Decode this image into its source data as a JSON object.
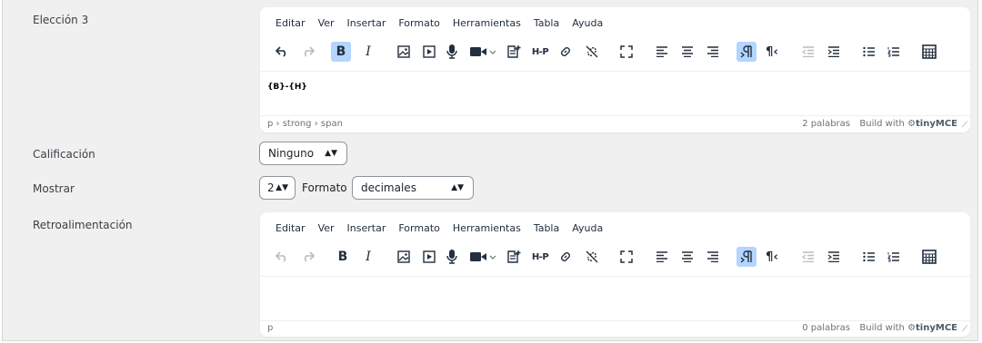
{
  "form": {
    "choice": {
      "label": "Elección 3"
    },
    "grade": {
      "label": "Calificación",
      "value": "Ninguno"
    },
    "show": {
      "label": "Mostrar",
      "value": "2",
      "format_label": "Formato",
      "format_value": "decimales"
    },
    "feedback": {
      "label": "Retroalimentación"
    }
  },
  "editor_menu": [
    "Editar",
    "Ver",
    "Insertar",
    "Formato",
    "Herramientas",
    "Tabla",
    "Ayuda"
  ],
  "editor1": {
    "content": "{B}-{H}",
    "path": "p › strong › span",
    "words": "2 palabras",
    "build_with": "Build with",
    "brand": "tinyMCE"
  },
  "editor2": {
    "content": "",
    "path": "p",
    "words": "0 palabras",
    "build_with": "Build with",
    "brand": "tinyMCE"
  },
  "toolbar_icons": [
    "undo-icon",
    "redo-icon",
    "bold-icon",
    "italic-icon",
    "image-icon",
    "media-icon",
    "microphone-icon",
    "video-icon",
    "h5p-insert-icon",
    "h5p-icon",
    "link-icon",
    "unlink-icon",
    "fullscreen-icon",
    "align-left-icon",
    "align-center-icon",
    "align-right-icon",
    "ltr-icon",
    "rtl-icon",
    "outdent-icon",
    "indent-icon",
    "bullet-list-icon",
    "numbered-list-icon",
    "calculator-icon"
  ],
  "toolbar_text": {
    "bold": "B",
    "italic": "I",
    "h5p": "H-P",
    "rtl": "¶‹"
  },
  "colors": {
    "panel": "#f0f0f1",
    "active_button": "#b3d5ff",
    "icon": "#222f3e",
    "disabled": "#b8bcc0"
  }
}
